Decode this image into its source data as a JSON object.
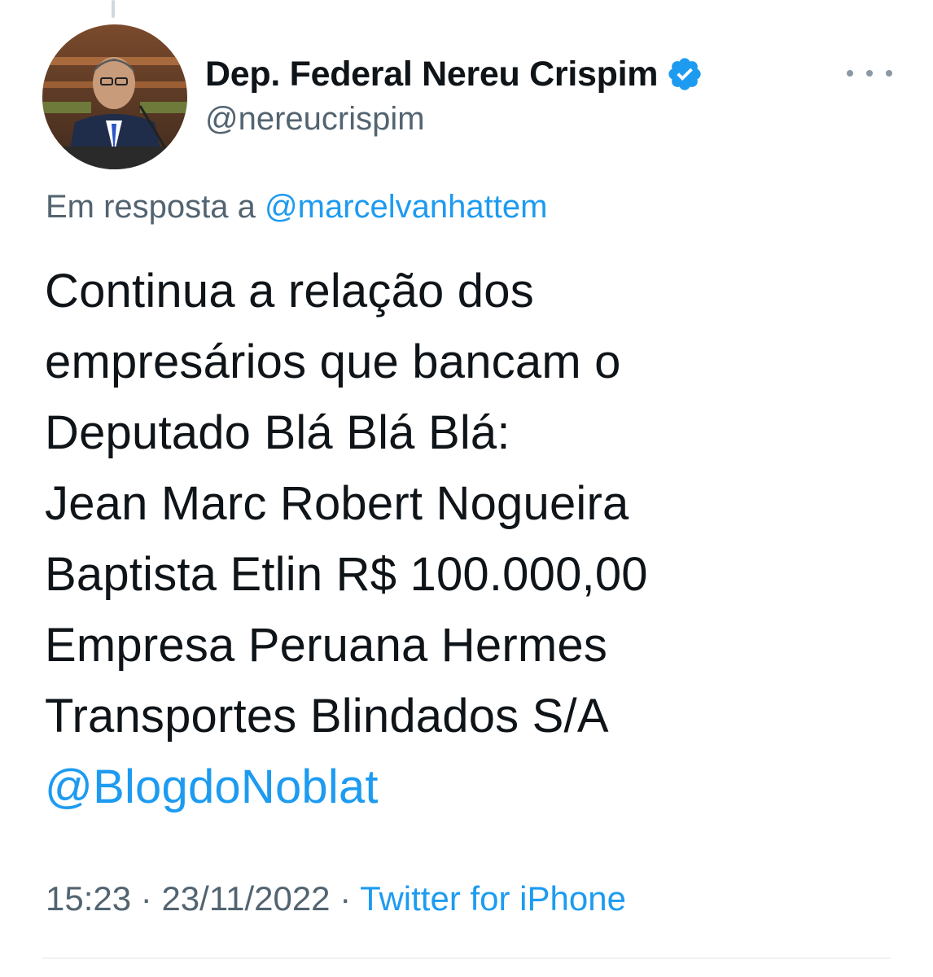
{
  "author": {
    "display_name": "Dep. Federal Nereu Crispim",
    "handle": "@nereucrispim",
    "verified_icon": "verified-badge-icon",
    "avatar_icon": "profile-photo"
  },
  "reply": {
    "prefix": "Em resposta a",
    "mention": "@marcelvanhattem"
  },
  "tweet": {
    "lines": [
      "Continua a relação dos",
      "empresários que bancam o",
      "Deputado Blá Blá Blá:",
      "Jean Marc Robert Nogueira",
      "Baptista Etlin R$ 100.000,00",
      "Empresa Peruana Hermes",
      "Transportes Blindados S/A"
    ],
    "mention": "@BlogdoNoblat"
  },
  "meta": {
    "time": "15:23",
    "separator": "·",
    "date": "23/11/2022",
    "source": "Twitter for iPhone"
  },
  "colors": {
    "link": "#1d9bf0",
    "secondary_text": "#536471",
    "primary_text": "#0f1419",
    "verified": "#1d9bf0"
  }
}
